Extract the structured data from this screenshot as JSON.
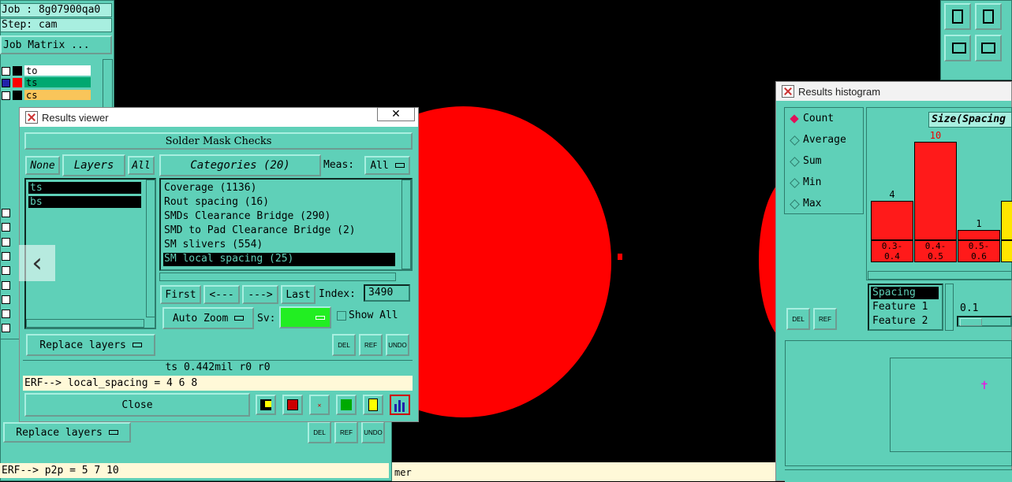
{
  "job": {
    "job_label": "Job : 8g07900qa0",
    "step_label": "Step: cam",
    "matrix_button": "Job Matrix ..."
  },
  "layer_list": [
    {
      "name": "to",
      "color": "#ffffff"
    },
    {
      "name": "ts",
      "color": "#00a870"
    },
    {
      "name": "cs",
      "color": "#f9c55a"
    }
  ],
  "results_viewer": {
    "title": "Results viewer",
    "section": "Solder Mask Checks",
    "none_btn": "None",
    "layers_btn": "Layers",
    "all_btn": "All",
    "layers": [
      "ts",
      "bs"
    ],
    "categories_btn": "Categories (20)",
    "meas_label": "Meas:",
    "meas_value": "All",
    "categories": [
      "Coverage (1136)",
      "Rout spacing (16)",
      "SMDs Clearance Bridge (290)",
      "SMD to Pad Clearance Bridge (2)",
      "SM slivers (554)",
      "SM local spacing (25)"
    ],
    "selected_category": 5,
    "first_btn": "First",
    "prev_btn": "<---",
    "next_btn": "--->",
    "last_btn": "Last",
    "index_label": "Index:",
    "index_value": "3490",
    "auto_zoom": "Auto Zoom",
    "sv_label": "Sv:",
    "show_all": "Show All",
    "replace_layers": "Replace layers",
    "del": "DEL",
    "ref": "REF",
    "undo": "UNDO",
    "status_line": "ts 0.442mil  r0  r0",
    "erf_line": "ERF--> local_spacing = 4 6 8",
    "close_btn": "Close"
  },
  "bg_window": {
    "replace_layers": "Replace layers",
    "del": "DEL",
    "ref": "REF",
    "undo": "UNDO",
    "erf_line": "ERF--> p2p = 5 7 10",
    "tail_text": "mer"
  },
  "histogram": {
    "title": "Results histogram",
    "modes": [
      "Count",
      "Average",
      "Sum",
      "Min",
      "Max"
    ],
    "selected_mode": 0,
    "chart_title": "Size(Spacing",
    "bars": [
      {
        "label": "0.3-\n0.4",
        "value": 4
      },
      {
        "label": "0.4-\n0.5",
        "value": 10
      },
      {
        "label": "0.5-\n0.6",
        "value": 1
      },
      {
        "label": "",
        "value": 4
      }
    ],
    "feature_list": [
      "Spacing",
      "Feature 1",
      "Feature 2"
    ],
    "slider_value": "0.1",
    "del": "DEL",
    "ref": "REF"
  },
  "colors": {
    "panel": "#5fd0b8",
    "pad": "#ff0000",
    "bar": "#ff1a1a",
    "bar_last": "#ffe600"
  }
}
